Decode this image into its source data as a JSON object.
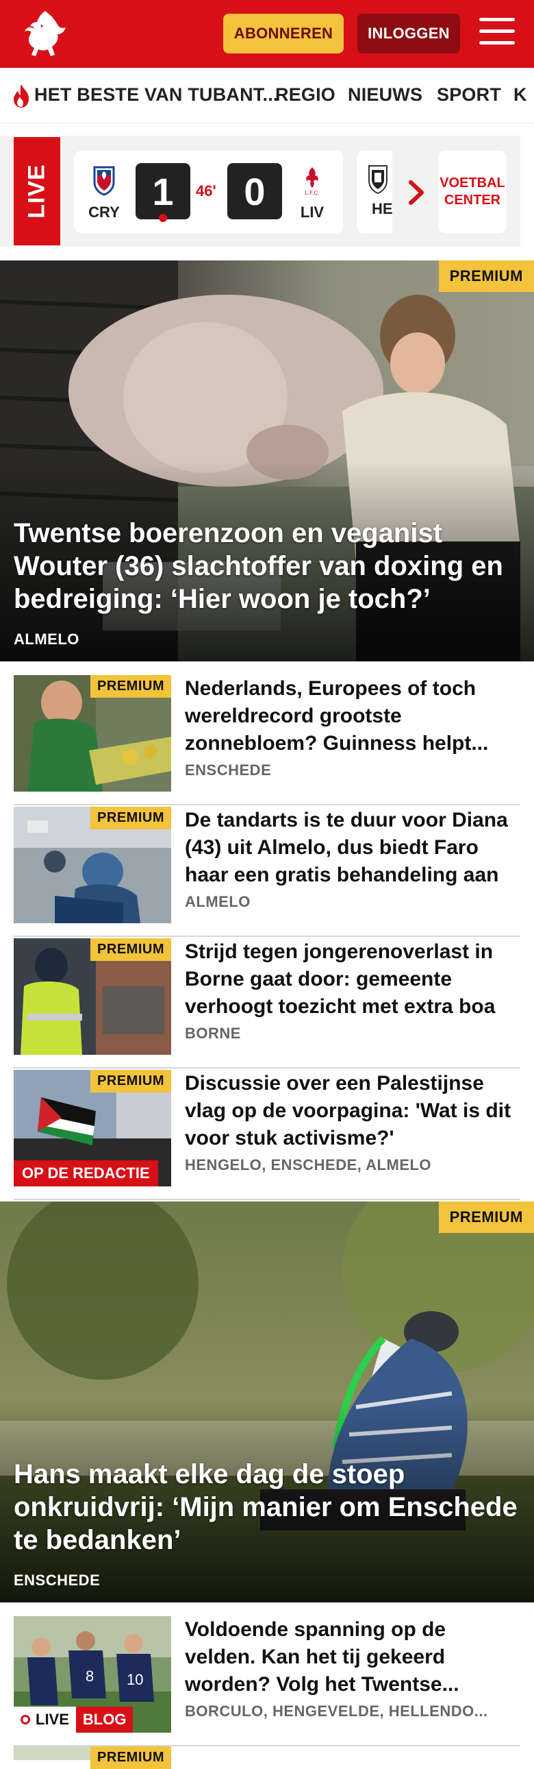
{
  "header": {
    "subscribe_label": "ABONNEREN",
    "login_label": "INLOGGEN",
    "brand_color": "#d70f17",
    "accent_color": "#f3c33c"
  },
  "nav": {
    "items": [
      "HET BESTE VAN TUBANT...",
      "REGIO",
      "NIEUWS",
      "SPORT",
      "K"
    ]
  },
  "live": {
    "label": "LIVE",
    "match": {
      "home": "CRY",
      "away": "LIV",
      "home_score": "1",
      "away_score": "0",
      "minute": "46'"
    },
    "next_team": "HE",
    "voetbal_center": "VOETBAL CENTER"
  },
  "hero1": {
    "badge": "PREMIUM",
    "title": "Twentse boerenzoon en veganist Wouter (36) slachtoffer van doxing en bedreiging: ‘Hier woon je toch?’",
    "location": "ALMELO"
  },
  "list1": [
    {
      "badge": "PREMIUM",
      "title": "Nederlands, Europees of toch wereldrecord grootste zonnebloem? Guinness helpt...",
      "location": "ENSCHEDE"
    },
    {
      "badge": "PREMIUM",
      "title": "De tandarts is te duur voor Diana (43) uit Almelo, dus biedt Faro haar een gratis behandeling aan",
      "location": "ALMELO"
    },
    {
      "badge": "PREMIUM",
      "title": "Strijd tegen jongerenoverlast in Borne gaat door: gemeente verhoogt toezicht met extra boa",
      "location": "BORNE"
    },
    {
      "badge": "PREMIUM",
      "tag": "OP DE REDACTIE",
      "title": "Discussie over een Palestijnse vlag op de voorpagina: 'Wat is dit voor stuk activisme?'",
      "location": "HENGELO, ENSCHEDE, ALMELO"
    }
  ],
  "hero2": {
    "badge": "PREMIUM",
    "title": "Hans maakt elke dag de stoep onkruidvrij: ‘Mijn manier om Enschede te bedanken’",
    "location": "ENSCHEDE"
  },
  "list2": [
    {
      "live_label": "LIVE",
      "blog_label": "BLOG",
      "title": "Voldoende spanning op de velden. Kan het tij gekeerd worden? Volg het Twentse...",
      "location": "BORCULO, HENGEVELDE, HELLENDO..."
    }
  ]
}
